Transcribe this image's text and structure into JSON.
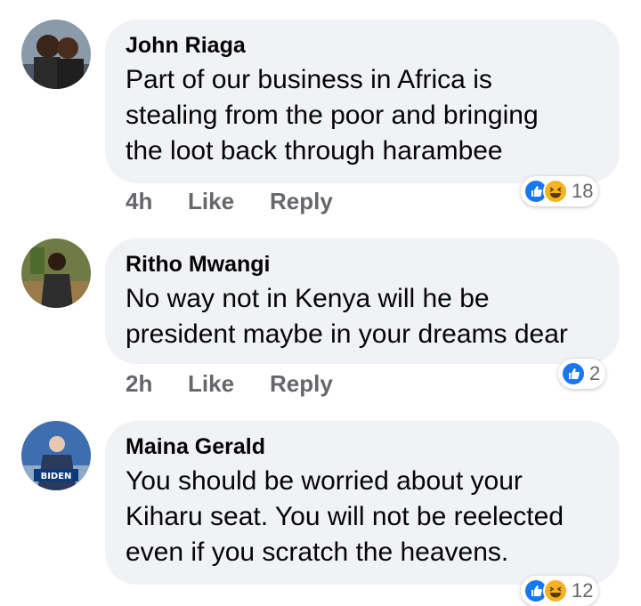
{
  "comments": [
    {
      "author": "John Riaga",
      "text_lines": [
        "Part of our business in Africa is",
        "stealing from the poor and bringing",
        "the loot back through harambee"
      ],
      "time": "4h",
      "like_label": "Like",
      "reply_label": "Reply",
      "reaction_count": "18"
    },
    {
      "author": "Ritho Mwangi",
      "text_lines": [
        "No way not in Kenya will he be",
        "president maybe in your dreams dear"
      ],
      "time": "2h",
      "like_label": "Like",
      "reply_label": "Reply",
      "reaction_count": "2"
    },
    {
      "author": "Maina Gerald",
      "text_lines": [
        "You should be worried about your",
        "Kiharu seat. You will not be reelected",
        "even if you scratch the heavens."
      ],
      "avatar_badge": "BIDEN",
      "reaction_count": "12"
    }
  ],
  "colors": {
    "like_blue": "#1877f2",
    "haha_yellow": "#f7b125",
    "bubble_bg": "#f0f2f5",
    "meta_gray": "#65676b"
  },
  "icons": {
    "like": "like-reaction-icon",
    "haha": "haha-reaction-icon"
  }
}
